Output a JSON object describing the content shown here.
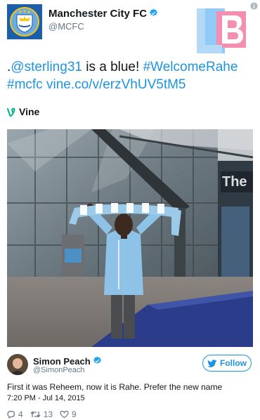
{
  "account": {
    "name": "Manchester City FC",
    "handle": "@MCFC",
    "avatar_icon": "manchester-city-crest"
  },
  "watermark": {
    "text": "LB"
  },
  "tweet": {
    "segments": [
      {
        "text": ".",
        "link": false
      },
      {
        "text": "@sterling31",
        "link": true
      },
      {
        "text": " is a blue! ",
        "link": false
      },
      {
        "text": "#WelcomeRahe",
        "link": true
      },
      {
        "text": " ",
        "link": false
      },
      {
        "text": "#mcfc",
        "link": true
      },
      {
        "text": " ",
        "link": false
      },
      {
        "text": "vine.co/v/erzVhUV5tM5",
        "link": true
      }
    ]
  },
  "vine": {
    "label": "Vine"
  },
  "media": {
    "building_sign": "The",
    "description_icon": "video-frame"
  },
  "reply": {
    "name": "Simon Peach",
    "handle": "@SimonPeach",
    "follow_label": "Follow",
    "text": "First it was Reheem, now it is Rahe. Prefer the new name",
    "timestamp": "7:20 PM - Jul 14, 2015",
    "replies": "4",
    "retweets": "13",
    "likes": "9"
  },
  "colors": {
    "link": "#1c94e0",
    "verified": "#1da1f2",
    "mcfc_blue": "#1c5ea8",
    "lb_pink": "#f48fb1",
    "lb_blue": "#90caf9"
  }
}
